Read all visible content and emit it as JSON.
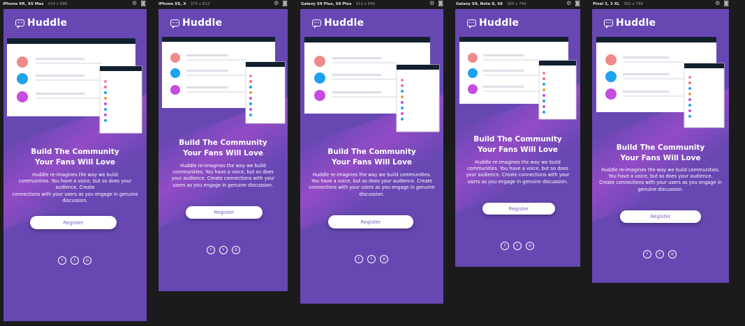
{
  "brand": "Huddle",
  "headline_line1": "Build The Community",
  "headline_line2": "Your Fans Will Love",
  "register_label": "Register",
  "social_icons": [
    "facebook-icon",
    "twitter-icon",
    "instagram-icon"
  ],
  "colors": {
    "bg": "#6748b3",
    "accent": "#d04ed6",
    "workspace": "#1b1b1e"
  },
  "frames": [
    {
      "device": "iPhone XR, XS Max",
      "dims": "414 x 896",
      "desc_lines": [
        "Huddle re-imagines the way we build",
        "communities. You have a voice, but so does your audience. Create",
        "connections with your users as you engage in genuine",
        "discussion."
      ]
    },
    {
      "device": "iPhone XS, X",
      "dims": "375 x 812",
      "desc_lines": [
        "Huddle re-imagines the way we build",
        "communities. You have a voice, but so does",
        "your audience. Create connections with your",
        "users as you engage in genuine discussion."
      ]
    },
    {
      "device": "Galaxy S9 Plus, S8 Plus",
      "dims": "412 x 846",
      "desc_lines": [
        "Huddle re-imagines the way we build communities.",
        "You have a voice, but so does your audience. Create",
        "connections with your users as you engage in genuine",
        "discussion."
      ]
    },
    {
      "device": "Galaxy S9, Note 8, S8",
      "dims": "360 x 740",
      "desc_lines": [
        "Huddle re-imagines the way we build",
        "communities. You have a voice, but so does",
        "your audience. Create connections with your",
        "users as you engage in genuine discussion."
      ]
    },
    {
      "device": "Pixel 3, 3 XL",
      "dims": "393 x 786",
      "desc_lines": [
        "Huddle re-imagines the way we build communities.",
        "You have a voice, but so does your audience.",
        "Create connections with your users as you engage in",
        "genuine discussion."
      ]
    }
  ]
}
